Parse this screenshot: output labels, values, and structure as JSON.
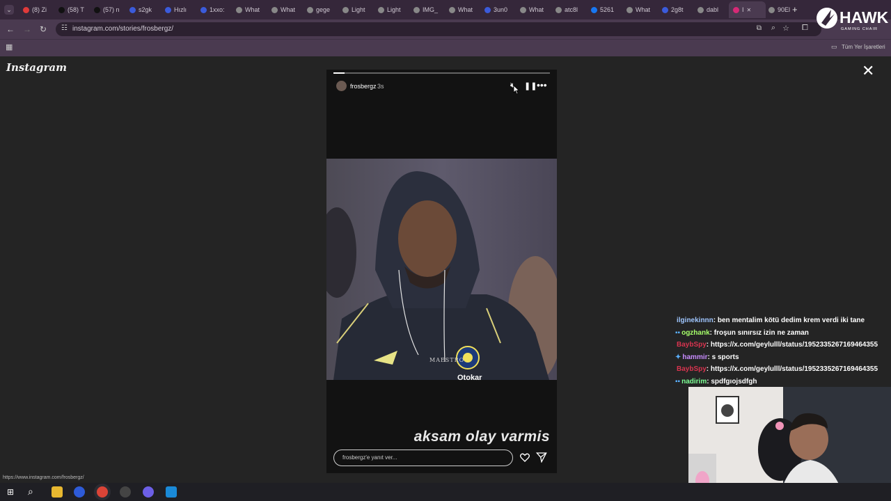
{
  "browser": {
    "tabs": [
      {
        "label": "(8) Zi",
        "fav_color": "#e03a3a"
      },
      {
        "label": "(58) T",
        "fav_color": "#111111"
      },
      {
        "label": "(57) n",
        "fav_color": "#111111"
      },
      {
        "label": "s2gk",
        "fav_color": "#3b5bdb"
      },
      {
        "label": "Hızlı",
        "fav_color": "#3b5bdb"
      },
      {
        "label": "1xxo:",
        "fav_color": "#3b5bdb"
      },
      {
        "label": "What",
        "fav_color": "#888888"
      },
      {
        "label": "What",
        "fav_color": "#888888"
      },
      {
        "label": "gege",
        "fav_color": "#888888"
      },
      {
        "label": "Light",
        "fav_color": "#888888"
      },
      {
        "label": "Light",
        "fav_color": "#888888"
      },
      {
        "label": "IMG_",
        "fav_color": "#888888"
      },
      {
        "label": "What",
        "fav_color": "#888888"
      },
      {
        "label": "3un0",
        "fav_color": "#3b5bdb"
      },
      {
        "label": "What",
        "fav_color": "#888888"
      },
      {
        "label": "atc8l",
        "fav_color": "#888888"
      },
      {
        "label": "5261",
        "fav_color": "#1877f2"
      },
      {
        "label": "What",
        "fav_color": "#888888"
      },
      {
        "label": "2g8t",
        "fav_color": "#3b5bdb"
      },
      {
        "label": "dabl",
        "fav_color": "#888888"
      },
      {
        "label": "I",
        "fav_color": "#d62976",
        "active": true
      },
      {
        "label": "90El",
        "fav_color": "#888888"
      }
    ],
    "new_tab": "+",
    "url": "instagram.com/stories/frosbergz/",
    "bookmarks_folder": "Tüm Yer İşaretleri"
  },
  "instagram": {
    "logo": "Instagram",
    "close": "✕",
    "story": {
      "username": "frosbergz",
      "time": "3s",
      "progress": 0.05,
      "caption": "aksam olay varmis",
      "reply_placeholder": "frosbergz'e yanıt ver...",
      "photo_text_1": "MAESTRO",
      "photo_text_2": "Otokar"
    }
  },
  "status_bar_url": "https://www.instagram.com/frosbergz/",
  "overlay": {
    "brand": "HAWK",
    "brand_sub": "GAMING CHAIR"
  },
  "chat": [
    {
      "user": "ilginekinnn",
      "color": "#9fc6ff",
      "msg": ": ben mentalim kötü dedim krem verdi iki tane",
      "badge": ""
    },
    {
      "user": "ogzhank",
      "color": "#a6ff6a",
      "msg": ": froşun sınırsız izin ne zaman",
      "badge": "▪▪"
    },
    {
      "user": "BaybSpy",
      "color": "#d8344f",
      "msg": ": https://x.com/geylulll/status/1952335267169464355",
      "badge": ""
    },
    {
      "user": "hammir",
      "color": "#c88cff",
      "msg": ": s sports",
      "badge": "✦"
    },
    {
      "user": "BaybSpy",
      "color": "#d8344f",
      "msg": ": https://x.com/geylulll/status/1952335267169464355",
      "badge": ""
    },
    {
      "user": "nadirim",
      "color": "#7dff95",
      "msg": ": spdfgıojsdfgh",
      "badge": "▪▪"
    }
  ]
}
